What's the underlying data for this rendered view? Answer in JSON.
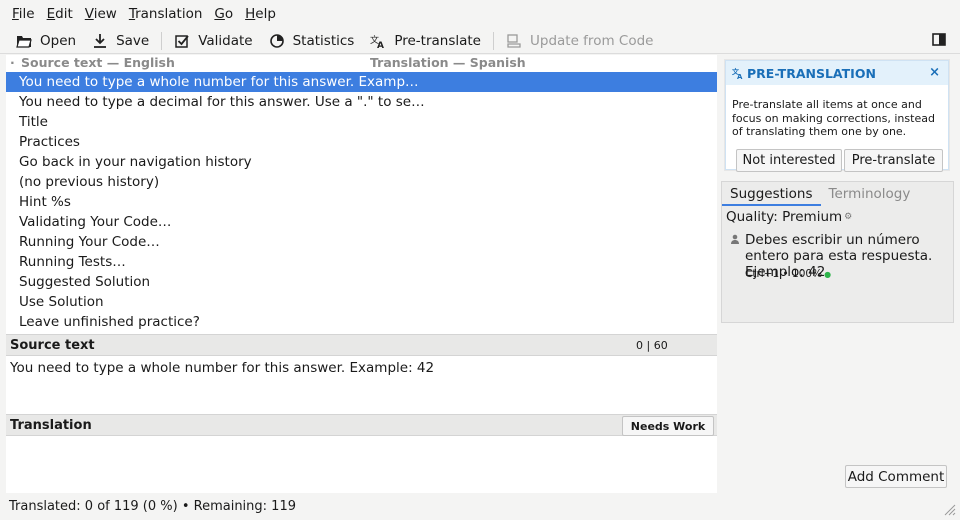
{
  "menubar": {
    "items": [
      {
        "accel": "F",
        "rest": "ile"
      },
      {
        "accel": "E",
        "rest": "dit"
      },
      {
        "accel": "V",
        "rest": "iew"
      },
      {
        "accel": "T",
        "rest": "ranslation"
      },
      {
        "accel": "G",
        "rest": "o"
      },
      {
        "accel": "H",
        "rest": "elp"
      }
    ]
  },
  "toolbar": {
    "open": "Open",
    "save": "Save",
    "validate": "Validate",
    "statistics": "Statistics",
    "pretranslate": "Pre-translate",
    "update_from_code": "Update from Code"
  },
  "list": {
    "source_header": "Source text — English",
    "translation_header": "Translation — Spanish",
    "rows": [
      "You need to type a whole number for this answer. Examp…",
      "You need to type a decimal for this answer. Use a \".\" to se…",
      "Title",
      "Practices",
      "Go back in your navigation history",
      "(no previous history)",
      "Hint %s",
      "Validating Your Code…",
      "Running Your Code…",
      "Running Tests…",
      "Suggested Solution",
      "Use Solution",
      "Leave unfinished practice?"
    ]
  },
  "editor": {
    "source_label": "Source text",
    "counter": "0 | 60",
    "source_text": "You need to type a whole number for this answer. Example: 42",
    "translation_label": "Translation",
    "needs_work": "Needs Work"
  },
  "status": {
    "text": "Translated: 0 of 119 (0 %)  •  Remaining: 119"
  },
  "pretranslation_card": {
    "title": "PRE-TRANSLATION",
    "close": "×",
    "body": "Pre-translate all items at once and focus on making corrections, instead of translating them one by one.",
    "not_interested": "Not interested",
    "pretranslate": "Pre-translate"
  },
  "suggestions": {
    "tab_suggestions": "Suggestions",
    "tab_terminology": "Terminology",
    "quality": "Quality: Premium",
    "item_text": "Debes escribir un número entero para esta respuesta. Ejemplo: 42",
    "item_meta": "Ctrl+1 • 100%"
  },
  "add_comment": "Add Comment",
  "colors": {
    "selection": "#3d7ee0",
    "accent": "#1a6fb8",
    "status_green": "#2db34a"
  }
}
